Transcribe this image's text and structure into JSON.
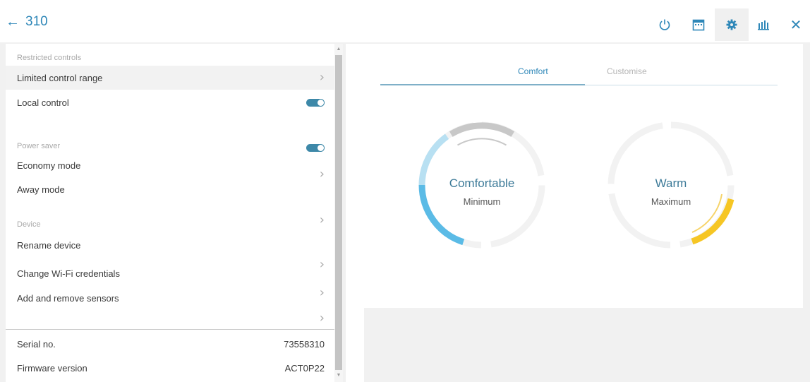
{
  "header": {
    "back_arrow": "←",
    "title": "310",
    "icons": [
      "power-icon",
      "calendar-icon",
      "gear-icon",
      "chart-icon",
      "close-icon"
    ],
    "close_label": "✕"
  },
  "settings": {
    "restricted_header": "Restricted controls",
    "limited_control_range": "Limited control range",
    "local_control": "Local control",
    "power_saver_header": "Power saver",
    "economy_mode": "Economy mode",
    "away_mode": "Away mode",
    "device_header": "Device",
    "rename_device": "Rename device",
    "change_wifi": "Change Wi-Fi credentials",
    "add_remove_sensors": "Add and remove sensors",
    "chevron": "›"
  },
  "info": {
    "serial_label": "Serial no.",
    "serial_value": "73558310",
    "firmware_label": "Firmware version",
    "firmware_value": "ACT0P22"
  },
  "tabs": {
    "comfort": "Comfort",
    "customise": "Customise"
  },
  "dials": {
    "left_title": "Comfortable",
    "left_sub": "Minimum",
    "right_title": "Warm",
    "right_sub": "Maximum"
  },
  "colors": {
    "accent": "#2e87b8",
    "toggle": "#3d88a8",
    "cool": "#5bbbe6",
    "cool_light": "#b8e0f2",
    "warm": "#f6c624",
    "track": "#f2f2f2",
    "grey_arc": "#c8c8c8"
  }
}
